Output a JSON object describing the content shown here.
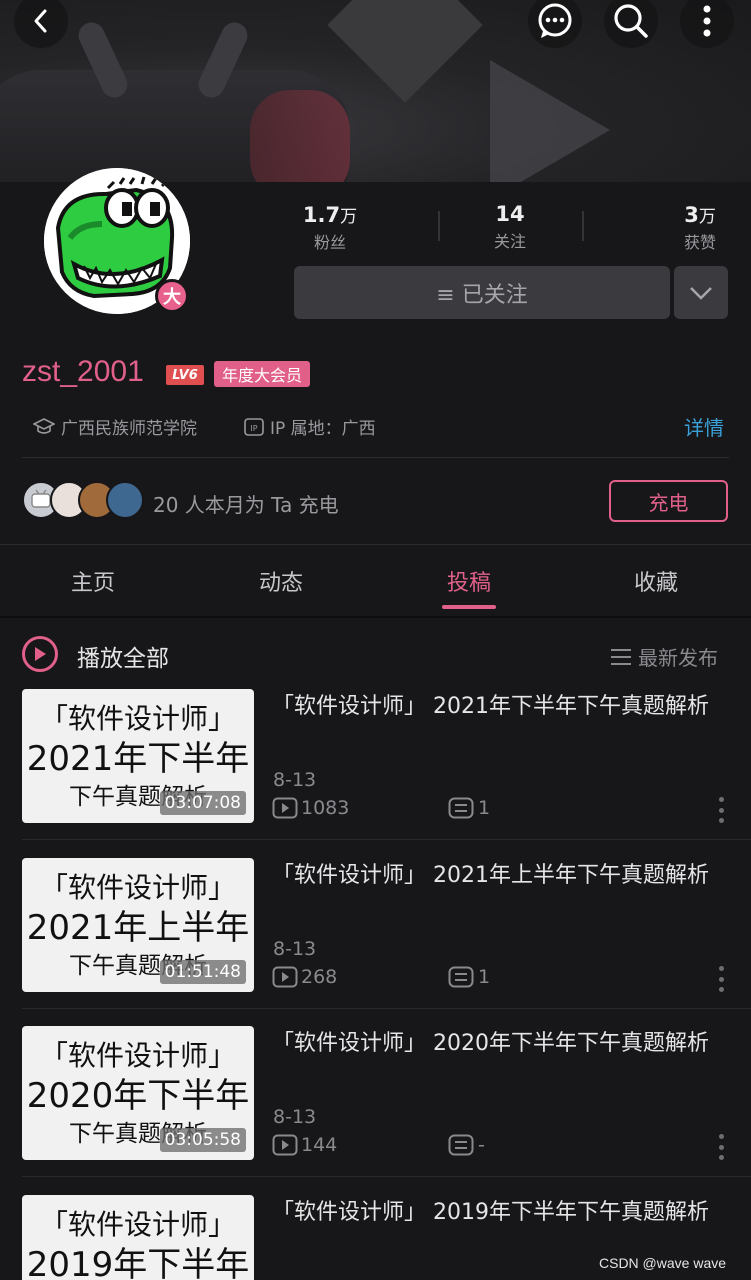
{
  "profile": {
    "username": "zst_2001",
    "level": "LV6",
    "vip_badge": "年度大会员",
    "avatar_badge": "大",
    "school": "广西民族师范学院",
    "ip_label": "IP 属地：广西",
    "detail_link": "详情"
  },
  "stats": [
    {
      "num": "1.7",
      "unit": "万",
      "label": "粉丝"
    },
    {
      "num": "14",
      "unit": "",
      "label": "关注"
    },
    {
      "num": "3",
      "unit": "万",
      "label": "获赞"
    }
  ],
  "follow": {
    "label": "≡ 已关注"
  },
  "charge": {
    "text": "20 人本月为 Ta 充电",
    "button": "充电"
  },
  "tabs": [
    "主页",
    "动态",
    "投稿",
    "收藏"
  ],
  "active_tab": "投稿",
  "play_all": {
    "label": "播放全部",
    "sort": "最新发布"
  },
  "videos": [
    {
      "thumb_l1": "「软件设计师」",
      "thumb_l2": "2021年下半年",
      "thumb_l3": "下午真题解析",
      "duration": "03:07:08",
      "title": "「软件设计师」 2021年下半年下午真题解析",
      "date": "8-13",
      "views": "1083",
      "comments": "1"
    },
    {
      "thumb_l1": "「软件设计师」",
      "thumb_l2": "2021年上半年",
      "thumb_l3": "下午真题解析",
      "duration": "01:51:48",
      "title": "「软件设计师」 2021年上半年下午真题解析",
      "date": "8-13",
      "views": "268",
      "comments": "1"
    },
    {
      "thumb_l1": "「软件设计师」",
      "thumb_l2": "2020年下半年",
      "thumb_l3": "下午真题解析",
      "duration": "03:05:58",
      "title": "「软件设计师」 2020年下半年下午真题解析",
      "date": "8-13",
      "views": "144",
      "comments": "-"
    },
    {
      "thumb_l1": "「软件设计师」",
      "thumb_l2": "2019年下半年",
      "thumb_l3": "",
      "duration": "",
      "title": "「软件设计师」 2019年下半年下午真题解析",
      "date": "",
      "views": "",
      "comments": ""
    }
  ],
  "watermark": "CSDN @wave wave",
  "colors": {
    "accent": "#e0608a",
    "link": "#3aa0d8",
    "background": "#17171a"
  }
}
